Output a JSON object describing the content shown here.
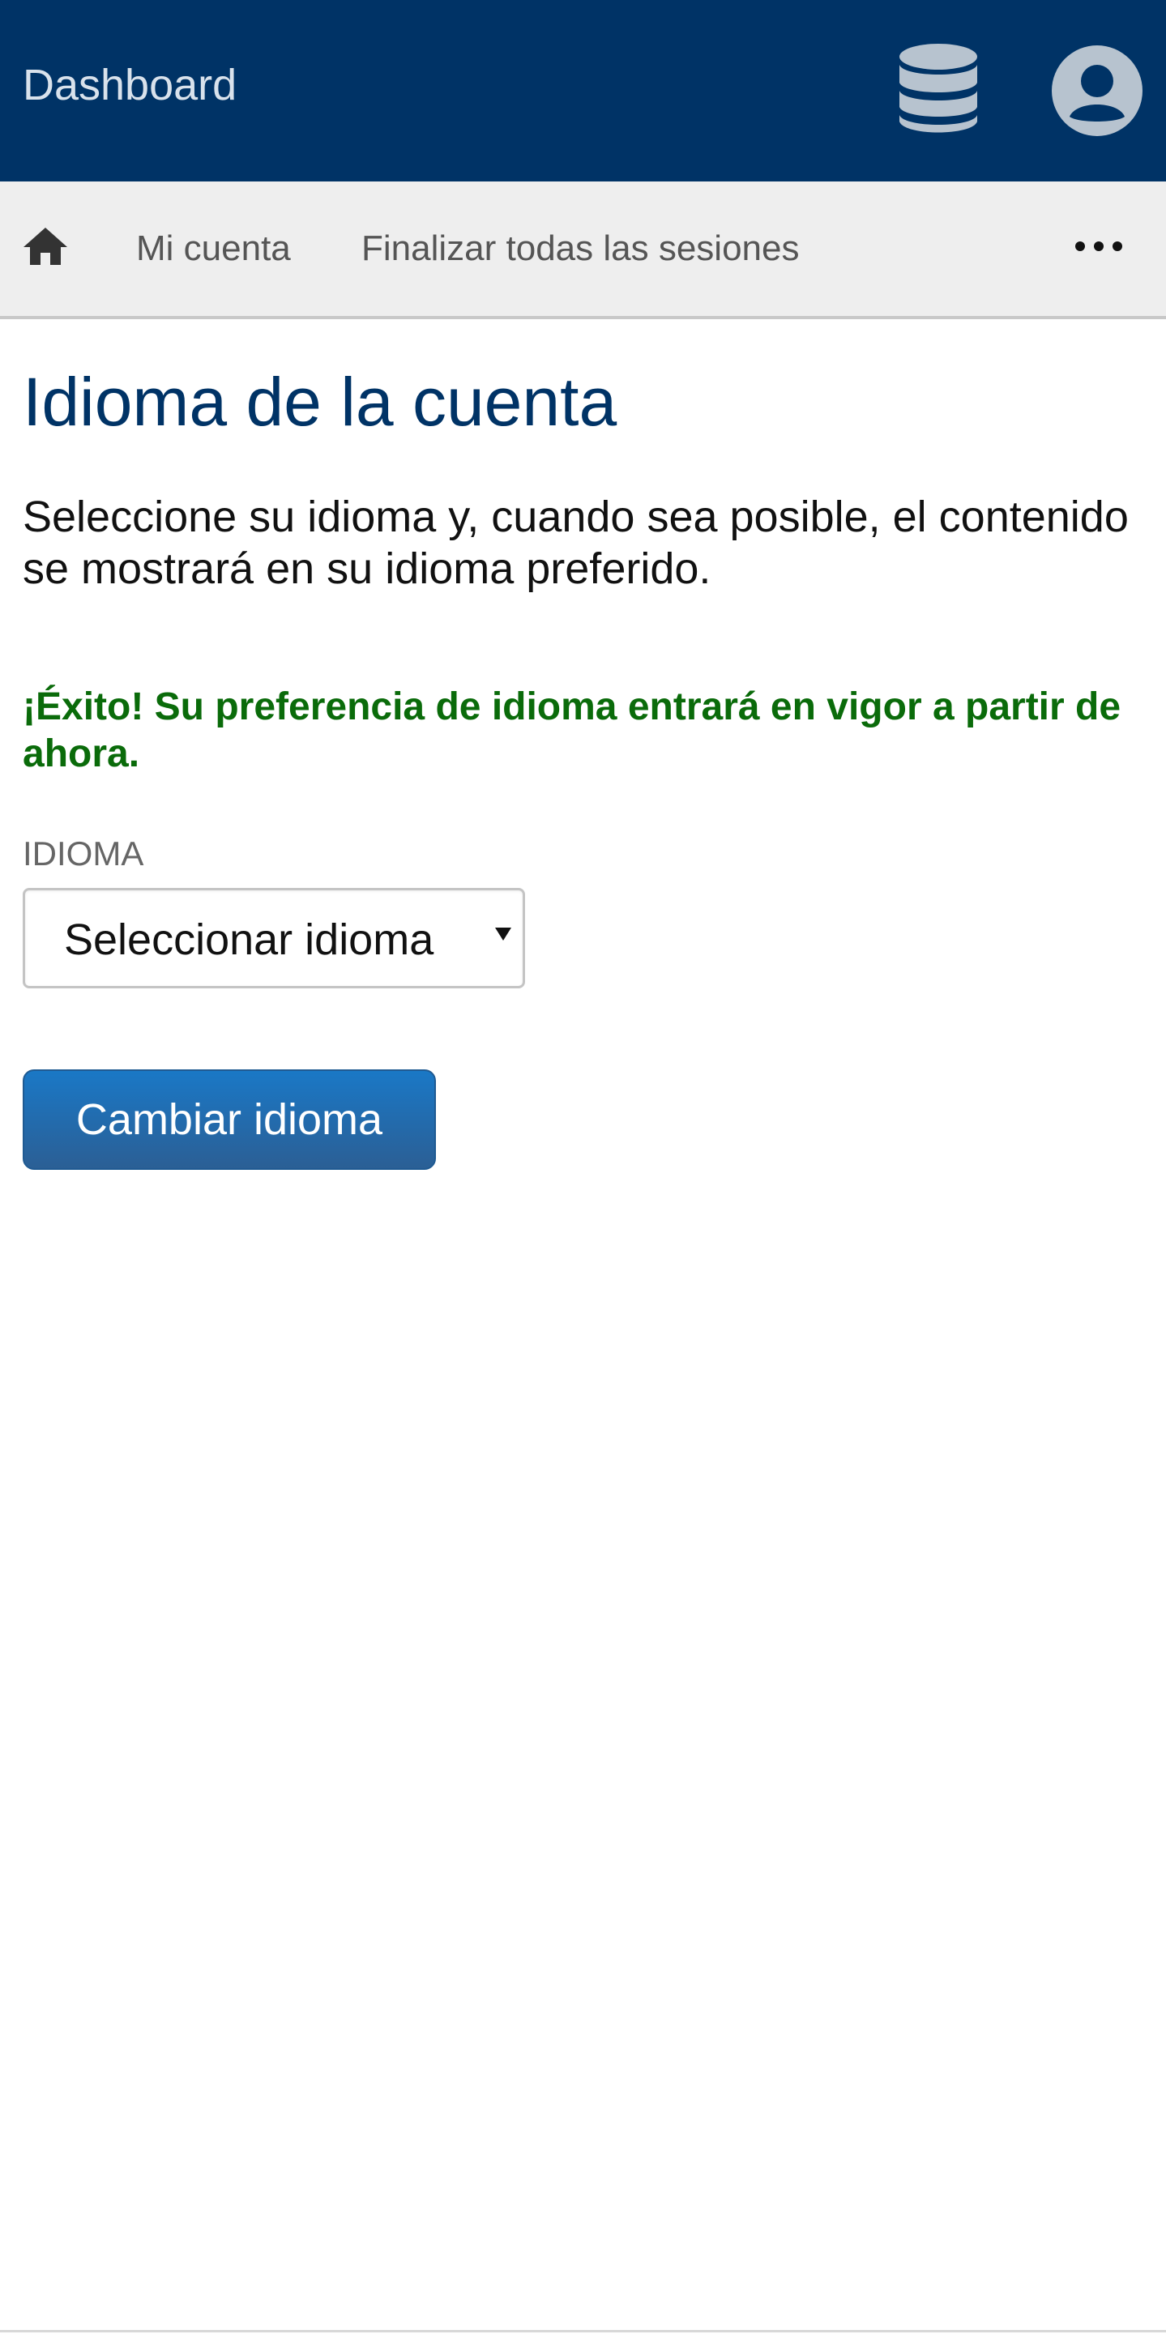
{
  "header": {
    "brand": "Dashboard",
    "database_icon": "database-icon",
    "user_icon": "user-circle-icon",
    "colors": {
      "background": "#003366",
      "brand_text": "#d9e2ec",
      "icons": "#b7c3cf"
    }
  },
  "nav": {
    "home_icon": "home-icon",
    "items": [
      {
        "label": "Mi cuenta"
      },
      {
        "label": "Finalizar todas las sesiones"
      }
    ],
    "more_icon": "more-horizontal-icon",
    "colors": {
      "background": "#eeeeee",
      "text": "#555555"
    }
  },
  "main": {
    "title": "Idioma de la cuenta",
    "description": "Seleccione su idioma y, cuando sea posible, el contenido se mostrará en su idioma preferido.",
    "success_message": "¡Éxito! Su preferencia de idioma entrará en vigor a partir de ahora.",
    "language_field": {
      "label": "IDIOMA",
      "selected_value": "Seleccionar idioma",
      "caret_icon": "caret-down-icon"
    },
    "submit_label": "Cambiar idioma",
    "colors": {
      "title": "#003366",
      "success": "#0a6b0a",
      "button": "#1a78c6"
    }
  }
}
